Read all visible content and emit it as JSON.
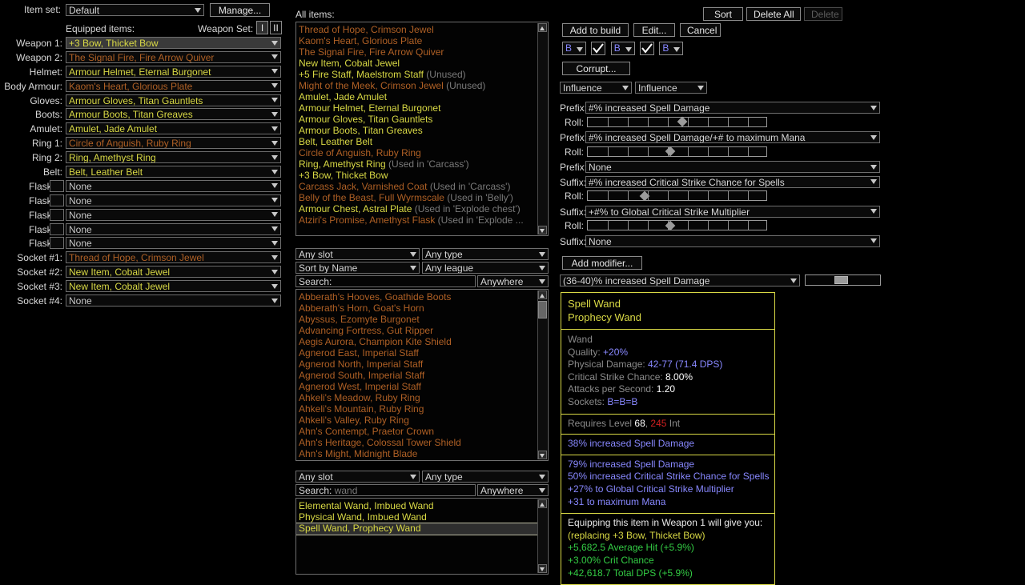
{
  "colors": {
    "unique": "#af6025",
    "rare": "#d9d945",
    "magic": "#8888ff",
    "normal": "#c8c8c8",
    "good": "#33cc44",
    "bad": "#d02020",
    "border": "#6e6e6e"
  },
  "left_panel": {
    "item_set_label": "Item set:",
    "item_set_value": "Default",
    "manage_button": "Manage...",
    "equipped_items_label": "Equipped items:",
    "weapon_set_label": "Weapon Set:",
    "weapon_set_buttons": [
      "I",
      "II"
    ],
    "slots": [
      {
        "label": "Weapon 1:",
        "value": "+3 Bow, Thicket Bow",
        "rarity": "rare",
        "selected": true,
        "flask_box": false
      },
      {
        "label": "Weapon 2:",
        "value": "The Signal Fire, Fire Arrow Quiver",
        "rarity": "unique",
        "selected": false,
        "flask_box": false
      },
      {
        "label": "Helmet:",
        "value": "Armour Helmet, Eternal Burgonet",
        "rarity": "rare",
        "selected": false,
        "flask_box": false
      },
      {
        "label": "Body Armour:",
        "value": "Kaom's Heart, Glorious Plate",
        "rarity": "unique",
        "selected": false,
        "flask_box": false
      },
      {
        "label": "Gloves:",
        "value": "Armour Gloves, Titan Gauntlets",
        "rarity": "rare",
        "selected": false,
        "flask_box": false
      },
      {
        "label": "Boots:",
        "value": "Armour Boots, Titan Greaves",
        "rarity": "rare",
        "selected": false,
        "flask_box": false
      },
      {
        "label": "Amulet:",
        "value": "Amulet, Jade Amulet",
        "rarity": "rare",
        "selected": false,
        "flask_box": false
      },
      {
        "label": "Ring 1:",
        "value": "Circle of Anguish, Ruby Ring",
        "rarity": "unique",
        "selected": false,
        "flask_box": false
      },
      {
        "label": "Ring 2:",
        "value": "Ring, Amethyst Ring",
        "rarity": "rare",
        "selected": false,
        "flask_box": false
      },
      {
        "label": "Belt:",
        "value": "Belt, Leather Belt",
        "rarity": "rare",
        "selected": false,
        "flask_box": false
      },
      {
        "label": "Flask 1:",
        "value": "None",
        "rarity": "normal",
        "selected": false,
        "flask_box": true
      },
      {
        "label": "Flask 2:",
        "value": "None",
        "rarity": "normal",
        "selected": false,
        "flask_box": true
      },
      {
        "label": "Flask 3:",
        "value": "None",
        "rarity": "normal",
        "selected": false,
        "flask_box": true
      },
      {
        "label": "Flask 4:",
        "value": "None",
        "rarity": "normal",
        "selected": false,
        "flask_box": true
      },
      {
        "label": "Flask 5:",
        "value": "None",
        "rarity": "normal",
        "selected": false,
        "flask_box": true
      },
      {
        "label": "Socket #1:",
        "value": "Thread of Hope, Crimson Jewel",
        "rarity": "unique",
        "selected": false,
        "flask_box": false
      },
      {
        "label": "Socket #2:",
        "value": "New Item, Cobalt Jewel",
        "rarity": "rare",
        "selected": false,
        "flask_box": false
      },
      {
        "label": "Socket #3:",
        "value": "New Item, Cobalt Jewel",
        "rarity": "rare",
        "selected": false,
        "flask_box": false
      },
      {
        "label": "Socket #4:",
        "value": "None",
        "rarity": "normal",
        "selected": false,
        "flask_box": false
      }
    ]
  },
  "all_items": {
    "title": "All items:",
    "sort_button": "Sort",
    "delete_all_button": "Delete All",
    "delete_button": "Delete",
    "delete_disabled": true,
    "rows": [
      {
        "name": "Thread of Hope, Crimson Jewel",
        "rarity": "unique",
        "note": ""
      },
      {
        "name": "Kaom's Heart, Glorious Plate",
        "rarity": "unique",
        "note": ""
      },
      {
        "name": "The Signal Fire, Fire Arrow Quiver",
        "rarity": "unique",
        "note": ""
      },
      {
        "name": "New Item, Cobalt Jewel",
        "rarity": "rare",
        "note": ""
      },
      {
        "name": "+5 Fire Staff, Maelstrom Staff",
        "rarity": "rare",
        "note": "(Unused)"
      },
      {
        "name": "Might of the Meek, Crimson Jewel",
        "rarity": "unique",
        "note": "(Unused)"
      },
      {
        "name": "Amulet, Jade Amulet",
        "rarity": "rare",
        "note": ""
      },
      {
        "name": "Armour Helmet, Eternal Burgonet",
        "rarity": "rare",
        "note": ""
      },
      {
        "name": "Armour Gloves, Titan Gauntlets",
        "rarity": "rare",
        "note": ""
      },
      {
        "name": "Armour Boots, Titan Greaves",
        "rarity": "rare",
        "note": ""
      },
      {
        "name": "Belt, Leather Belt",
        "rarity": "rare",
        "note": ""
      },
      {
        "name": "Circle of Anguish, Ruby Ring",
        "rarity": "unique",
        "note": ""
      },
      {
        "name": "Ring, Amethyst Ring",
        "rarity": "rare",
        "note": "(Used in 'Carcass')"
      },
      {
        "name": "+3 Bow, Thicket Bow",
        "rarity": "rare",
        "note": ""
      },
      {
        "name": "Carcass Jack, Varnished Coat",
        "rarity": "unique",
        "note": "(Used in 'Carcass')"
      },
      {
        "name": "Belly of the Beast, Full Wyrmscale",
        "rarity": "unique",
        "note": "(Used in 'Belly')"
      },
      {
        "name": "Armour Chest, Astral Plate",
        "rarity": "rare",
        "note": "(Used in 'Explode chest')"
      },
      {
        "name": "Atziri's Promise, Amethyst Flask",
        "rarity": "unique",
        "note": "(Used in 'Explode ..."
      }
    ]
  },
  "unique_filter": {
    "slot_select": "Any slot",
    "type_select": "Any type",
    "sort_select": "Sort by Name",
    "league_select": "Any league",
    "search_label": "Search:",
    "search_value": "",
    "search_mode": "Anywhere"
  },
  "unique_list": {
    "rows": [
      {
        "name": "Abberath's Hooves, Goathide Boots",
        "rarity": "unique"
      },
      {
        "name": "Abberath's Horn, Goat's Horn",
        "rarity": "unique"
      },
      {
        "name": "Abyssus, Ezomyte Burgonet",
        "rarity": "unique"
      },
      {
        "name": "Advancing Fortress, Gut Ripper",
        "rarity": "unique"
      },
      {
        "name": "Aegis Aurora, Champion Kite Shield",
        "rarity": "unique"
      },
      {
        "name": "Agnerod East, Imperial Staff",
        "rarity": "unique"
      },
      {
        "name": "Agnerod North, Imperial Staff",
        "rarity": "unique"
      },
      {
        "name": "Agnerod South, Imperial Staff",
        "rarity": "unique"
      },
      {
        "name": "Agnerod West, Imperial Staff",
        "rarity": "unique"
      },
      {
        "name": "Ahkeli's Meadow, Ruby Ring",
        "rarity": "unique"
      },
      {
        "name": "Ahkeli's Mountain, Ruby Ring",
        "rarity": "unique"
      },
      {
        "name": "Ahkeli's Valley, Ruby Ring",
        "rarity": "unique"
      },
      {
        "name": "Ahn's Contempt, Praetor Crown",
        "rarity": "unique"
      },
      {
        "name": "Ahn's Heritage, Colossal Tower Shield",
        "rarity": "unique"
      },
      {
        "name": "Ahn's Might, Midnight Blade",
        "rarity": "unique"
      }
    ]
  },
  "template_filter": {
    "slot_select": "Any slot",
    "type_select": "Any type",
    "search_label": "Search:",
    "search_value": "wand",
    "search_mode": "Anywhere"
  },
  "template_list": {
    "rows": [
      {
        "name": "Elemental Wand, Imbued Wand",
        "rarity": "rare",
        "selected": false
      },
      {
        "name": "Physical Wand, Imbued Wand",
        "rarity": "rare",
        "selected": false
      },
      {
        "name": "Spell Wand, Prophecy Wand",
        "rarity": "rare",
        "selected": true
      }
    ]
  },
  "craft": {
    "add_to_build_button": "Add to build",
    "edit_button": "Edit...",
    "cancel_button": "Cancel",
    "corrupt_button": "Corrupt...",
    "add_modifier_button": "Add modifier...",
    "sockets": [
      {
        "color": "B"
      },
      {
        "color": "B"
      },
      {
        "color": "B"
      }
    ],
    "links": [
      "checked",
      "checked"
    ],
    "influence_1": "Influence",
    "influence_2": "Influence",
    "roll_label": "Roll:",
    "mods": [
      {
        "kind": "Prefix:",
        "value": "#% increased Spell Damage",
        "has_roll": true,
        "roll_pct": 53
      },
      {
        "kind": "Prefix:",
        "value": "#% increased Spell Damage/+# to maximum Mana",
        "has_roll": true,
        "roll_pct": 46
      },
      {
        "kind": "Prefix:",
        "value": "None",
        "has_roll": false,
        "roll_pct": 0
      },
      {
        "kind": "Suffix:",
        "value": "#% increased Critical Strike Chance for Spells",
        "has_roll": true,
        "roll_pct": 32
      },
      {
        "kind": "Suffix:",
        "value": "+#% to Global Critical Strike Multiplier",
        "has_roll": true,
        "roll_pct": 46
      },
      {
        "kind": "Suffix:",
        "value": "None",
        "has_roll": false,
        "roll_pct": 0
      }
    ],
    "modifier_select": "(36-40)% increased Spell Damage",
    "modifier_slider_pct": 47
  },
  "item_tooltip": {
    "name_line1": "Spell Wand",
    "name_line2": "Prophecy Wand",
    "base_stats": [
      {
        "key": "",
        "value": "Wand",
        "key_only": true
      },
      {
        "key": "Quality: ",
        "value": "+20%"
      },
      {
        "key": "Physical Damage: ",
        "value": "42-77 (71.4 DPS)"
      },
      {
        "key": "Critical Strike Chance: ",
        "value": "8.00%",
        "white": true
      },
      {
        "key": "Attacks per Second: ",
        "value": "1.20",
        "white": true
      },
      {
        "key": "Sockets: ",
        "value": "B=B=B"
      }
    ],
    "requires_prefix": "Requires Level ",
    "requires_level": "68",
    "requires_sep": ", ",
    "requires_int": "245",
    "requires_suffix": " Int",
    "quality_mod": "38% increased Spell Damage",
    "explicit_mods": [
      "79% increased Spell Damage",
      "50% increased Critical Strike Chance for Spells",
      "+27% to Global Critical Strike Multiplier",
      "+31 to maximum Mana"
    ],
    "compare_header": "Equipping this item in Weapon 1 will give you:",
    "compare_replacing": "(replacing +3 Bow, Thicket Bow)",
    "compare_lines": [
      "+5,682.5 Average Hit (+5.9%)",
      "+3.00% Crit Chance",
      "+42,618.7 Total DPS (+5.9%)"
    ]
  }
}
